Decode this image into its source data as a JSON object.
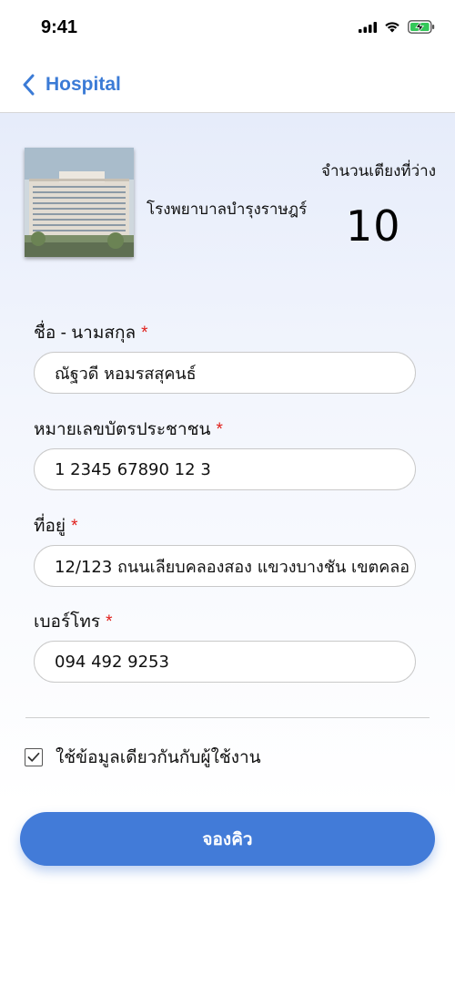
{
  "status_bar": {
    "time": "9:41"
  },
  "nav": {
    "back_label": "Hospital"
  },
  "hospital": {
    "name": "โรงพยาบาลบำรุงราษฎร์",
    "beds_label": "จำนวนเตียงที่ว่าง",
    "beds_count": "10"
  },
  "form": {
    "required_mark": "*",
    "fields": [
      {
        "label": "ชื่อ - นามสกุล",
        "value": "ณัฐวดี หอมรสสุคนธ์"
      },
      {
        "label": "หมายเลขบัตรประชาชน",
        "value": "1 2345 67890 12 3"
      },
      {
        "label": "ที่อยู่",
        "value": "12/123 ถนนเลียบคลองสอง แขวงบางชัน เขตคลอ"
      },
      {
        "label": "เบอร์โทร",
        "value": "094 492 9253"
      }
    ],
    "same_as_user_label": "ใช้ข้อมูลเดียวกันกับผู้ใช้งาน",
    "same_as_user_checked": true
  },
  "book_button_label": "จองคิว",
  "colors": {
    "accent": "#3b7bd6",
    "button": "#427bd8",
    "required": "#e0201c",
    "battery": "#34c759"
  }
}
